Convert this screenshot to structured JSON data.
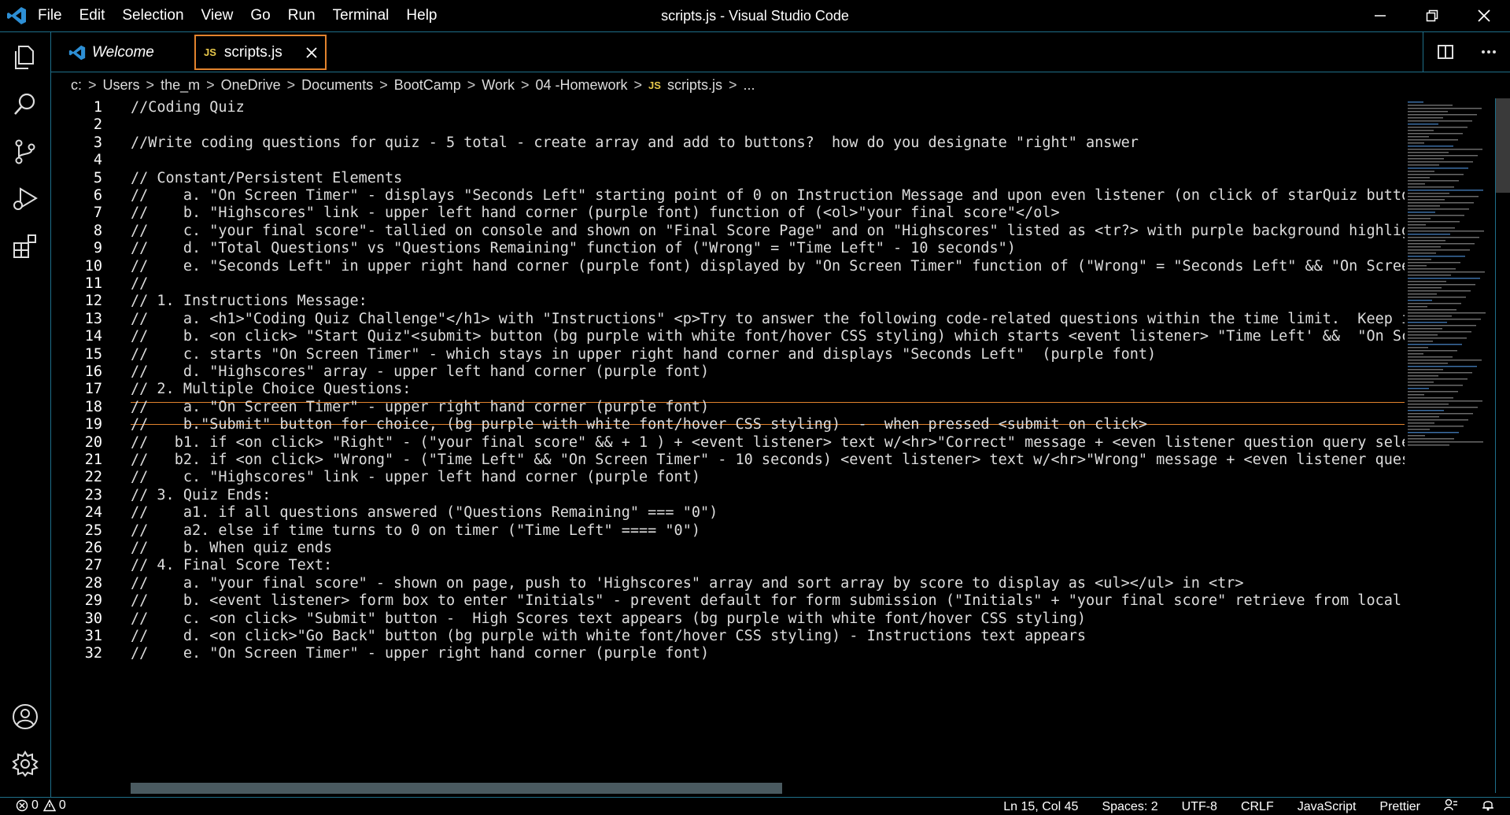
{
  "window": {
    "title": "scripts.js - Visual Studio Code"
  },
  "menu": [
    "File",
    "Edit",
    "Selection",
    "View",
    "Go",
    "Run",
    "Terminal",
    "Help"
  ],
  "tabs": [
    {
      "label": "Welcome"
    },
    {
      "label": "scripts.js",
      "badge": "JS"
    }
  ],
  "breadcrumb": [
    "c:",
    "Users",
    "the_m",
    "OneDrive",
    "Documents",
    "BootCamp",
    "Work",
    "04 -Homework",
    "scripts.js",
    "..."
  ],
  "breadcrumb_file_badge": "JS",
  "editor": {
    "lines": [
      {
        "n": "1",
        "text": "//Coding Quiz"
      },
      {
        "n": "2",
        "text": ""
      },
      {
        "n": "3",
        "text": "//Write coding questions for quiz - 5 total - create array and add to buttons?  how do you designate \"right\" answer"
      },
      {
        "n": "4",
        "text": ""
      },
      {
        "n": "5",
        "text": "// Constant/Persistent Elements"
      },
      {
        "n": "6",
        "text": "//    a. \"On Screen Timer\" - displays \"Seconds Left\" starting point of 0 on Instruction Message and upon even listener (on click of starQuiz butto"
      },
      {
        "n": "7",
        "text": "//    b. \"Highscores\" link - upper left hand corner (purple font) function of (<ol>\"your final score\"</ol>"
      },
      {
        "n": "8",
        "text": "//    c. \"your final score\"- tallied on console and shown on \"Final Score Page\" and on \"Highscores\" listed as <tr?> with purple background highlig"
      },
      {
        "n": "9",
        "text": "//    d. \"Total Questions\" vs \"Questions Remaining\" function of (\"Wrong\" = \"Time Left\" - 10 seconds\")"
      },
      {
        "n": "10",
        "text": "//    e. \"Seconds Left\" in upper right hand corner (purple font) displayed by \"On Screen Timer\" function of (\"Wrong\" = \"Seconds Left\" && \"On Scree"
      },
      {
        "n": "11",
        "text": "//"
      },
      {
        "n": "12",
        "text": "// 1. Instructions Message:"
      },
      {
        "n": "13",
        "text": "//    a. <h1>\"Coding Quiz Challenge\"</h1> with \"Instructions\" <p>Try to answer the following code-related questions within the time limit.  Keep i"
      },
      {
        "n": "14",
        "text": "//    b. <on click> \"Start Quiz\"<submit> button (bg purple with white font/hover CSS styling) which starts <event listener> \"Time Left' &&  \"On Sc"
      },
      {
        "n": "15",
        "text": "//    c. starts \"On Screen Timer\" - which stays in upper right hand corner and displays \"Seconds Left\"  (purple font)"
      },
      {
        "n": "16",
        "text": "//    d. \"Highscores\" array - upper left hand corner (purple font)"
      },
      {
        "n": "17",
        "text": "// 2. Multiple Choice Questions:"
      },
      {
        "n": "18",
        "text": "//    a. \"On Screen Timer\" - upper right hand corner (purple font)"
      },
      {
        "n": "19",
        "text": "//    b.\"Submit\" button for choice, (bg purple with white font/hover CSS styling)  -  when pressed <submit on click>"
      },
      {
        "n": "20",
        "text": "//   b1. if <on click> \"Right\" - (\"your final score\" && + 1 ) + <event listener> text w/<hr>\"Correct\" message + <even listener question query sele"
      },
      {
        "n": "21",
        "text": "//   b2. if <on click> \"Wrong\" - (\"Time Left\" && \"On Screen Timer\" - 10 seconds) <event listener> text w/<hr>\"Wrong\" message + <even listener ques"
      },
      {
        "n": "22",
        "text": "//    c. \"Highscores\" link - upper left hand corner (purple font)"
      },
      {
        "n": "23",
        "text": "// 3. Quiz Ends:"
      },
      {
        "n": "24",
        "text": "//    a1. if all questions answered (\"Questions Remaining\" === \"0\")"
      },
      {
        "n": "25",
        "text": "//    a2. else if time turns to 0 on timer (\"Time Left\" ==== \"0\")"
      },
      {
        "n": "26",
        "text": "//    b. When quiz ends"
      },
      {
        "n": "27",
        "text": "// 4. Final Score Text:"
      },
      {
        "n": "28",
        "text": "//    a. \"your final score\" - shown on page, push to 'Highscores\" array and sort array by score to display as <ul></ul> in <tr>"
      },
      {
        "n": "29",
        "text": "//    b. <event listener> form box to enter \"Initials\" - prevent default for form submission (\"Initials\" + \"your final score\" retrieve from local"
      },
      {
        "n": "30",
        "text": "//    c. <on click> \"Submit\" button -  High Scores text appears (bg purple with white font/hover CSS styling)"
      },
      {
        "n": "31",
        "text": "//    d. <on click>\"Go Back\" button (bg purple with white font/hover CSS styling) - Instructions text appears"
      },
      {
        "n": "32",
        "text": "//    e. \"On Screen Timer\" - upper right hand corner (purple font)"
      }
    ]
  },
  "status": {
    "errors": "0",
    "warnings": "0",
    "position": "Ln 15, Col 45",
    "spaces": "Spaces: 2",
    "encoding": "UTF-8",
    "eol": "CRLF",
    "language": "JavaScript",
    "formatter": "Prettier"
  },
  "colors": {
    "accent": "#1e6f8a",
    "active_tab_border": "#e2832d",
    "js_badge": "#e8c84b",
    "vscode_blue": "#2d8fd5"
  }
}
